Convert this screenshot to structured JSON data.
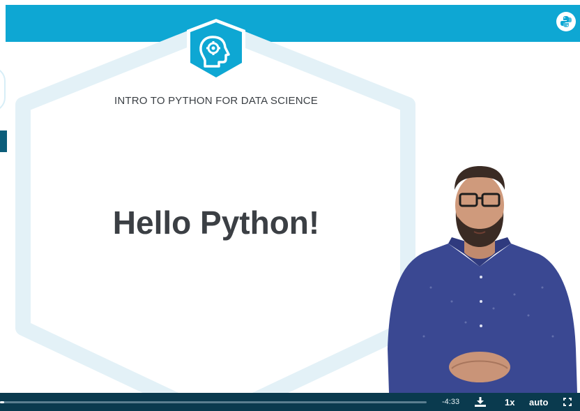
{
  "slide": {
    "course_title": "INTRO TO PYTHON FOR DATA SCIENCE",
    "heading": "Hello Python!"
  },
  "player": {
    "time_remaining": "-4:33",
    "speed": "1x",
    "quality": "auto",
    "progress_fraction": 0.01
  },
  "colors": {
    "accent": "#0ea7d3",
    "control_bar": "#0a3a4e",
    "heading": "#3b3f44"
  },
  "icons": {
    "brand": "python-logo-icon",
    "course_logo": "brain-head-icon",
    "download": "download-icon",
    "fullscreen": "fullscreen-icon"
  }
}
